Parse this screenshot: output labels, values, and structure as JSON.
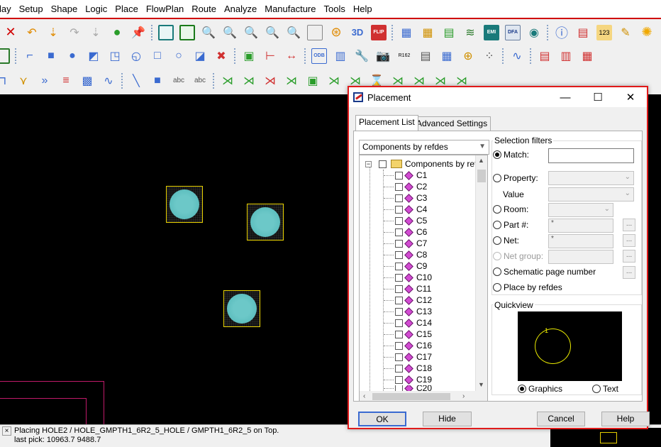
{
  "menu": [
    "lay",
    "Setup",
    "Shape",
    "Logic",
    "Place",
    "FlowPlan",
    "Route",
    "Analyze",
    "Manufacture",
    "Tools",
    "Help"
  ],
  "toolbar": {
    "icon3d": "3D",
    "flip": "FLIP",
    "icon123": "123",
    "odb": "ODB",
    "r162": "R162",
    "emi": "EMI",
    "dfa": "DFA"
  },
  "status": {
    "line1": "Placing HOLE2 / HOLE_GMPTH1_6R2_5_HOLE / GMPTH1_6R2_5 on Top.",
    "line2": "last pick:  10963.7 9488.7",
    "close": "×"
  },
  "dialog": {
    "title": "Placement",
    "tabs": [
      "Placement List",
      "Advanced Settings"
    ],
    "list_mode": "Components by refdes",
    "tree_root": "Components by refc",
    "items": [
      "C1",
      "C2",
      "C3",
      "C4",
      "C5",
      "C6",
      "C7",
      "C8",
      "C9",
      "C10",
      "C11",
      "C12",
      "C13",
      "C14",
      "C15",
      "C16",
      "C17",
      "C18",
      "C19",
      "C20"
    ],
    "filters": {
      "group": "Selection filters",
      "match": "Match:",
      "match_value": "",
      "property": "Property:",
      "value": "Value",
      "room": "Room:",
      "part": "Part #:",
      "part_value": "*",
      "net": "Net:",
      "net_value": "*",
      "net_group": "Net group:",
      "schematic": "Schematic page number",
      "place_by_refdes": "Place by refdes",
      "ellipsis": "..."
    },
    "quickview": {
      "label": "Quickview",
      "graphics": "Graphics",
      "text": "Text",
      "ref": "1"
    },
    "buttons": {
      "ok": "OK",
      "hide": "Hide",
      "cancel": "Cancel",
      "help": "Help"
    }
  }
}
